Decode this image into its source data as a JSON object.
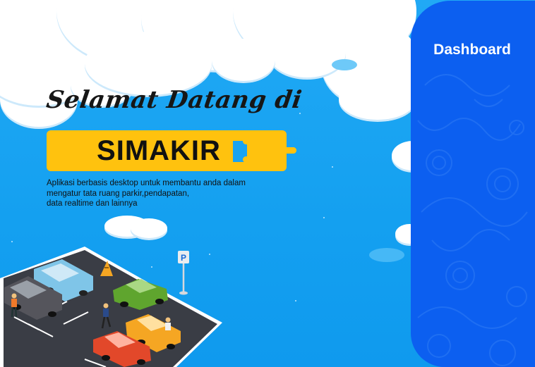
{
  "welcome": {
    "greeting": "Selamat Datang di",
    "app_name": "SIMAKIR",
    "description_lines": [
      "Aplikasi berbasis desktop untuk membantu anda dalam",
      "mengatur tata ruang parkir,pendapatan,",
      "data realtime dan lainnya"
    ]
  },
  "sidebar": {
    "dashboard_label": "Dashboard"
  },
  "parking_sign": {
    "letter": "P"
  },
  "colors": {
    "sky": "#1aa3f2",
    "sidebar": "#0c5ff0",
    "banner": "#ffc20e",
    "asphalt": "#3a3d45"
  },
  "icons": [
    "parking-sign-icon",
    "cone-sign-icon"
  ]
}
